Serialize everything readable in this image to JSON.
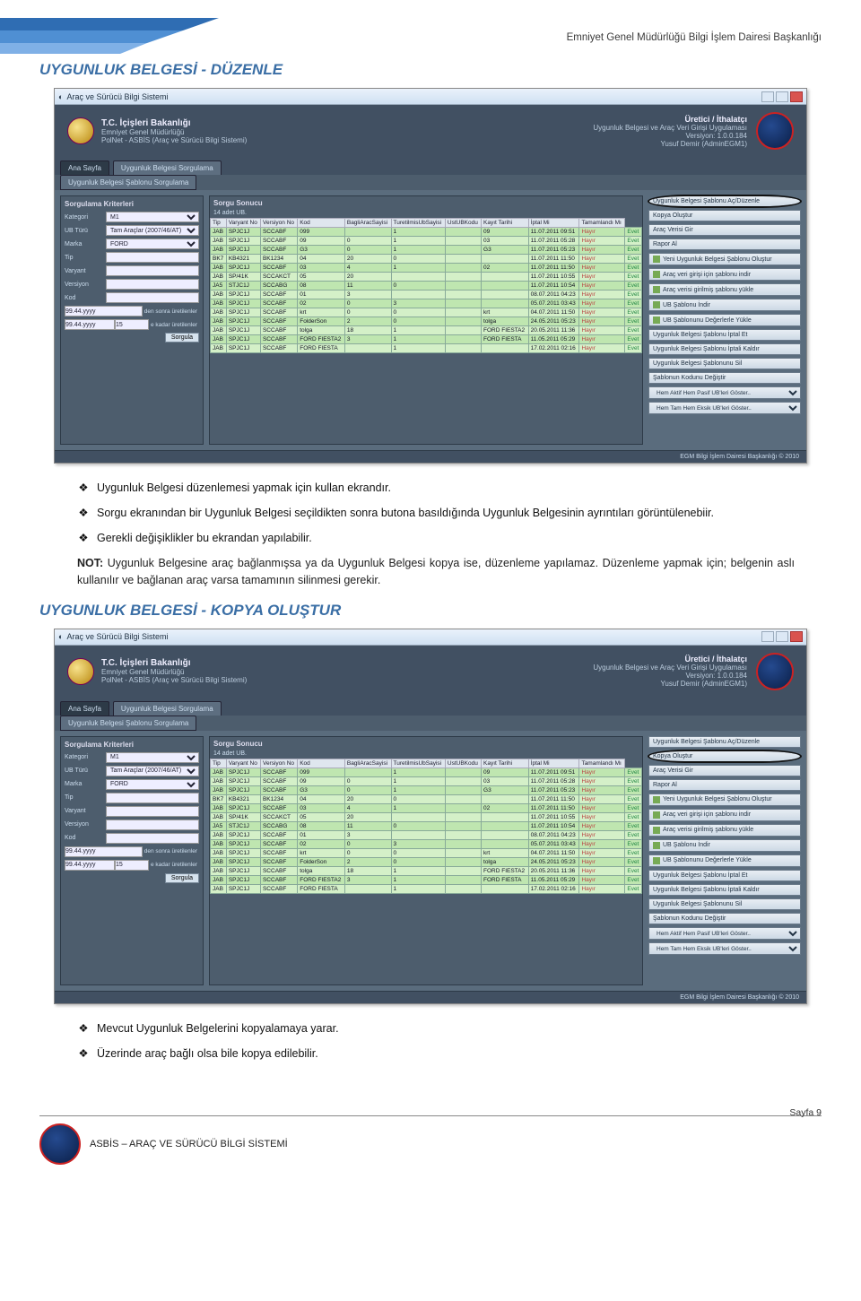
{
  "header_right": "Emniyet Genel Müdürlüğü Bilgi İşlem Dairesi Başkanlığı",
  "section1_title": "UYGUNLUK BELGESİ - DÜZENLE",
  "section2_title": "UYGUNLUK BELGESİ - KOPYA OLUŞTUR",
  "titlebar": "Araç ve Sürücü Bilgi Sistemi",
  "header_left": {
    "line1": "T.C. İçişleri Bakanlığı",
    "line2": "Emniyet Genel Müdürlüğü",
    "line3": "PolNet - ASBİS (Araç ve Sürücü Bilgi Sistemi)"
  },
  "header_right_app": {
    "line1": "Üretici / İthalatçı",
    "line2": "Uygunluk Belgesi ve Araç Veri Girişi Uygulaması",
    "line3": "Versiyon: 1.0.0.184",
    "line4": "Yusuf Demir (AdminEGM1)"
  },
  "tabs": {
    "t1": "Ana Sayfa",
    "t2": "Uygunluk Belgesi Sorgulama"
  },
  "subtab": "Uygunluk Belgesi Şablonu Sorgulama",
  "criteria": {
    "title": "Sorgulama Kriterleri",
    "kategori_lbl": "Kategori",
    "kategori": "M1",
    "ubturu_lbl": "UB Türü",
    "ubturu": "Tam Araçlar (2007/46/AT)",
    "marka_lbl": "Marka",
    "marka": "FORD",
    "tip_lbl": "Tip",
    "tip": "",
    "varyant_lbl": "Varyant",
    "varyant": "",
    "versiyon_lbl": "Versiyon",
    "versiyon": "",
    "kod_lbl": "Kod",
    "kod": "",
    "from": "99.44.yyyy",
    "from_note": "den sonra üretilenler",
    "to": "99.44.yyyy",
    "to_val": "15",
    "to_note": "e kadar üretilenler",
    "sorgula": "Sorgula"
  },
  "results_title": "Sorgu Sonucu",
  "results_count": "14 adet UB.",
  "cols": [
    "Tip",
    "Varyant No",
    "Versiyon No",
    "Kod",
    "BagliAracSayisi",
    "TuretilmisUbSayisi",
    "UstUBKodu",
    "Kayıt Tarihi",
    "İptal Mi",
    "Tamamlandı Mı"
  ],
  "rows": [
    [
      "JAB",
      "SPJC1J",
      "SCCABF",
      "099",
      "",
      "1",
      "",
      "09",
      "11.07.2011 09:51",
      "Hayır",
      "Evet"
    ],
    [
      "JAB",
      "SPJC1J",
      "SCCABF",
      "09",
      "0",
      "1",
      "",
      "03",
      "11.07.2011 05:28",
      "Hayır",
      "Evet"
    ],
    [
      "JAB",
      "SPJC1J",
      "SCCABF",
      "G3",
      "0",
      "1",
      "",
      "G3",
      "11.07.2011 05:23",
      "Hayır",
      "Evet"
    ],
    [
      "BK7",
      "KB4321",
      "BK1234",
      "04",
      "20",
      "0",
      "",
      "",
      "11.07.2011 11:50",
      "Hayır",
      "Evet"
    ],
    [
      "JAB",
      "SPJC1J",
      "SCCABF",
      "03",
      "4",
      "1",
      "",
      "02",
      "11.07.2011 11:50",
      "Hayır",
      "Evet"
    ],
    [
      "JAB",
      "SP/41K",
      "SCCAKCT",
      "05",
      "20",
      "",
      "",
      "",
      "11.07.2011 10:55",
      "Hayır",
      "Evet"
    ],
    [
      "JA5",
      "STJC1J",
      "SCCABG",
      "08",
      "11",
      "0",
      "",
      "",
      "11.07.2011 10:54",
      "Hayır",
      "Evet"
    ],
    [
      "JAB",
      "SPJC1J",
      "SCCABF",
      "01",
      "3",
      "",
      "",
      "",
      "08.07.2011 04:23",
      "Hayır",
      "Evet"
    ],
    [
      "JAB",
      "SPJC1J",
      "SCCABF",
      "02",
      "0",
      "3",
      "",
      "",
      "05.07.2011 03:43",
      "Hayır",
      "Evet"
    ],
    [
      "JAB",
      "SPJC1J",
      "SCCABF",
      "krt",
      "0",
      "0",
      "",
      "krt",
      "04.07.2011 11:50",
      "Hayır",
      "Evet"
    ],
    [
      "JAB",
      "SPJC1J",
      "SCCABF",
      "FolderSon",
      "2",
      "0",
      "",
      "tolga",
      "24.05.2011 05:23",
      "Hayır",
      "Evet"
    ],
    [
      "JAB",
      "SPJC1J",
      "SCCABF",
      "tolga",
      "18",
      "1",
      "",
      "FORD FIESTA2",
      "20.05.2011 11:36",
      "Hayır",
      "Evet"
    ],
    [
      "JAB",
      "SPJC1J",
      "SCCABF",
      "FORD FIESTA2",
      "3",
      "1",
      "",
      "FORD FIESTA",
      "11.05.2011 05:29",
      "Hayır",
      "Evet"
    ],
    [
      "JAB",
      "SPJC1J",
      "SCCABF",
      "FORD FIESTA",
      "",
      "1",
      "",
      "",
      "17.02.2011 02:16",
      "Hayır",
      "Evet"
    ]
  ],
  "actions1": [
    "Uygunluk Belgesi Şablonu Aç/Düzenle",
    "Kopya Oluştur",
    "Araç Verisi Gir",
    "Rapor Al",
    "Yeni Uygunluk Belgesi Şablonu Oluştur",
    "Araç veri girişi için şablonu indir",
    "Araç verisi girilmiş şablonu yükle",
    "UB Şablonu İndir",
    "UB Şablonunu Değerlerle Yükle",
    "Uygunluk Belgesi Şablonu İptal Et",
    "Uygunluk Belgesi Şablonu İptali Kaldır",
    "Uygunluk Belgesi Şablonunu Sil",
    "Şablonun Kodunu Değiştir",
    "Hem Aktif Hem Pasif UB'leri Göster..",
    "Hem Tam Hem Eksik UB'leri Göster.."
  ],
  "actions2_circled": 1,
  "app_footer": "EGM Bilgi İşlem Dairesi Başkanlığı © 2010",
  "bullets1": [
    "Uygunluk Belgesi düzenlemesi yapmak için kullan ekrandır.",
    "Sorgu ekranından bir Uygunluk Belgesi seçildikten sonra butona basıldığında Uygunluk Belgesinin ayrıntıları görüntülenebiir.",
    "Gerekli değişiklikler bu ekrandan yapılabilir."
  ],
  "note1_bold": "NOT:",
  "note1": " Uygunluk Belgesine araç bağlanmışsa ya da Uygunluk Belgesi kopya ise, düzenleme yapılamaz. Düzenleme yapmak için; belgenin aslı kullanılır  ve bağlanan araç varsa tamamının silinmesi gerekir.",
  "bullets2": [
    "Mevcut Uygunluk Belgelerini kopyalamaya yarar.",
    "Üzerinde araç bağlı olsa bile kopya edilebilir."
  ],
  "footer_text": "ASBİS – ARAÇ VE SÜRÜCÜ BİLGİ SİSTEMİ",
  "page_no": "Sayfa 9"
}
